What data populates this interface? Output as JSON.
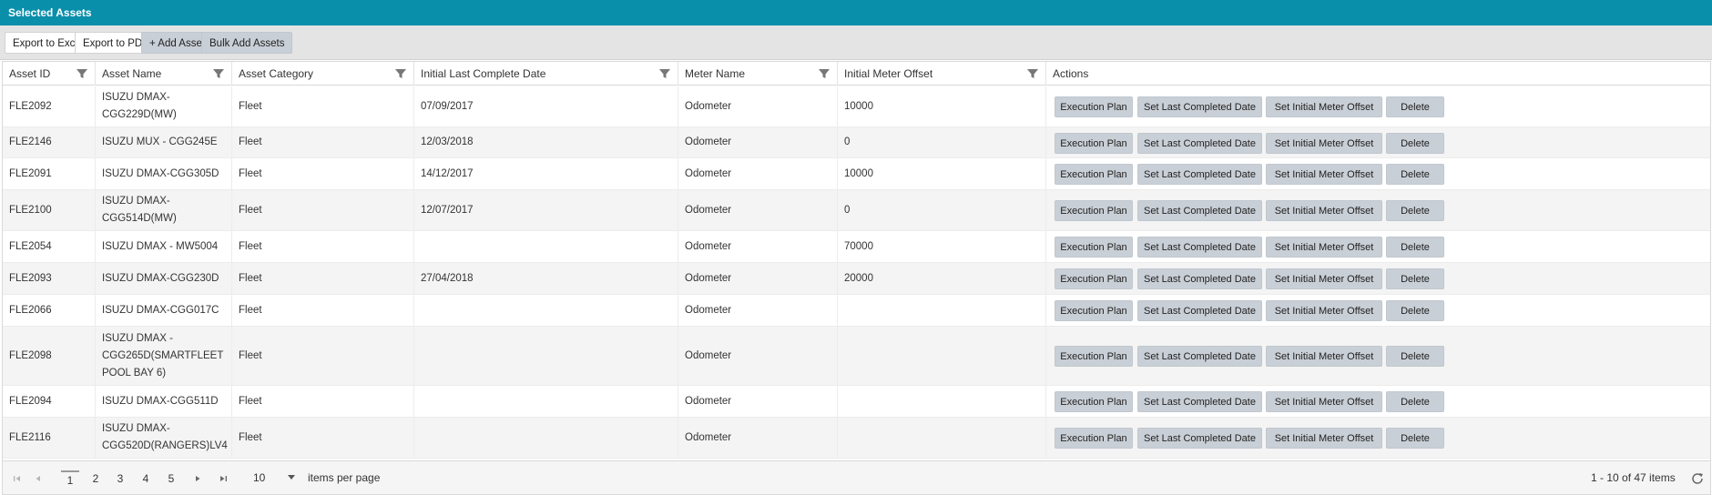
{
  "panel": {
    "title": "Selected Assets"
  },
  "toolbar": {
    "export_excel": "Export to Excel",
    "export_pdf": "Export to PDF",
    "add_asset": "+ Add Asset",
    "bulk_add": "Bulk Add Assets"
  },
  "columns": [
    {
      "label": "Asset ID",
      "filter": true
    },
    {
      "label": "Asset Name",
      "filter": true
    },
    {
      "label": "Asset Category",
      "filter": true
    },
    {
      "label": "Initial Last Complete Date",
      "filter": true
    },
    {
      "label": "Meter Name",
      "filter": true
    },
    {
      "label": "Initial Meter Offset",
      "filter": true
    },
    {
      "label": "Actions",
      "filter": false
    }
  ],
  "actions": {
    "execution_plan": "Execution Plan",
    "set_last_completed": "Set Last Completed Date",
    "set_initial_meter": "Set Initial Meter Offset",
    "delete": "Delete"
  },
  "rows": [
    {
      "asset_id": "FLE2092",
      "asset_name": [
        "ISUZU DMAX-",
        "CGG229D(MW)"
      ],
      "category": "Fleet",
      "last_complete": "07/09/2017",
      "meter": "Odometer",
      "offset": "10000"
    },
    {
      "asset_id": "FLE2146",
      "asset_name": [
        "ISUZU MUX - CGG245E"
      ],
      "category": "Fleet",
      "last_complete": "12/03/2018",
      "meter": "Odometer",
      "offset": "0"
    },
    {
      "asset_id": "FLE2091",
      "asset_name": [
        "ISUZU DMAX-CGG305D"
      ],
      "category": "Fleet",
      "last_complete": "14/12/2017",
      "meter": "Odometer",
      "offset": "10000"
    },
    {
      "asset_id": "FLE2100",
      "asset_name": [
        "ISUZU DMAX-",
        "CGG514D(MW)"
      ],
      "category": "Fleet",
      "last_complete": "12/07/2017",
      "meter": "Odometer",
      "offset": "0"
    },
    {
      "asset_id": "FLE2054",
      "asset_name": [
        "ISUZU DMAX - MW5004"
      ],
      "category": "Fleet",
      "last_complete": "",
      "meter": "Odometer",
      "offset": "70000"
    },
    {
      "asset_id": "FLE2093",
      "asset_name": [
        "ISUZU DMAX-CGG230D"
      ],
      "category": "Fleet",
      "last_complete": "27/04/2018",
      "meter": "Odometer",
      "offset": "20000"
    },
    {
      "asset_id": "FLE2066",
      "asset_name": [
        "ISUZU DMAX-CGG017C"
      ],
      "category": "Fleet",
      "last_complete": "",
      "meter": "Odometer",
      "offset": ""
    },
    {
      "asset_id": "FLE2098",
      "asset_name": [
        "ISUZU DMAX -",
        "CGG265D(SMARTFLEET",
        "POOL BAY 6)"
      ],
      "category": "Fleet",
      "last_complete": "",
      "meter": "Odometer",
      "offset": ""
    },
    {
      "asset_id": "FLE2094",
      "asset_name": [
        "ISUZU DMAX-CGG511D"
      ],
      "category": "Fleet",
      "last_complete": "",
      "meter": "Odometer",
      "offset": ""
    },
    {
      "asset_id": "FLE2116",
      "asset_name": [
        "ISUZU DMAX-",
        "CGG520D(RANGERS)LV4"
      ],
      "category": "Fleet",
      "last_complete": "",
      "meter": "Odometer",
      "offset": ""
    }
  ],
  "pager": {
    "pages": [
      "1",
      "2",
      "3",
      "4",
      "5"
    ],
    "current_page": "1",
    "page_size": "10",
    "page_size_label": "items per page",
    "info": "1 - 10 of 47 items"
  },
  "colors": {
    "titlebar": "#0a8fab",
    "button_gray": "#c9cfd6",
    "row_alt": "#f4f4f4"
  },
  "icons": {
    "filter": "filter-icon",
    "first_page": "first-page-icon",
    "prev_page": "prev-page-icon",
    "next_page": "next-page-icon",
    "last_page": "last-page-icon",
    "dropdown": "chevron-down-icon",
    "refresh": "refresh-icon"
  }
}
